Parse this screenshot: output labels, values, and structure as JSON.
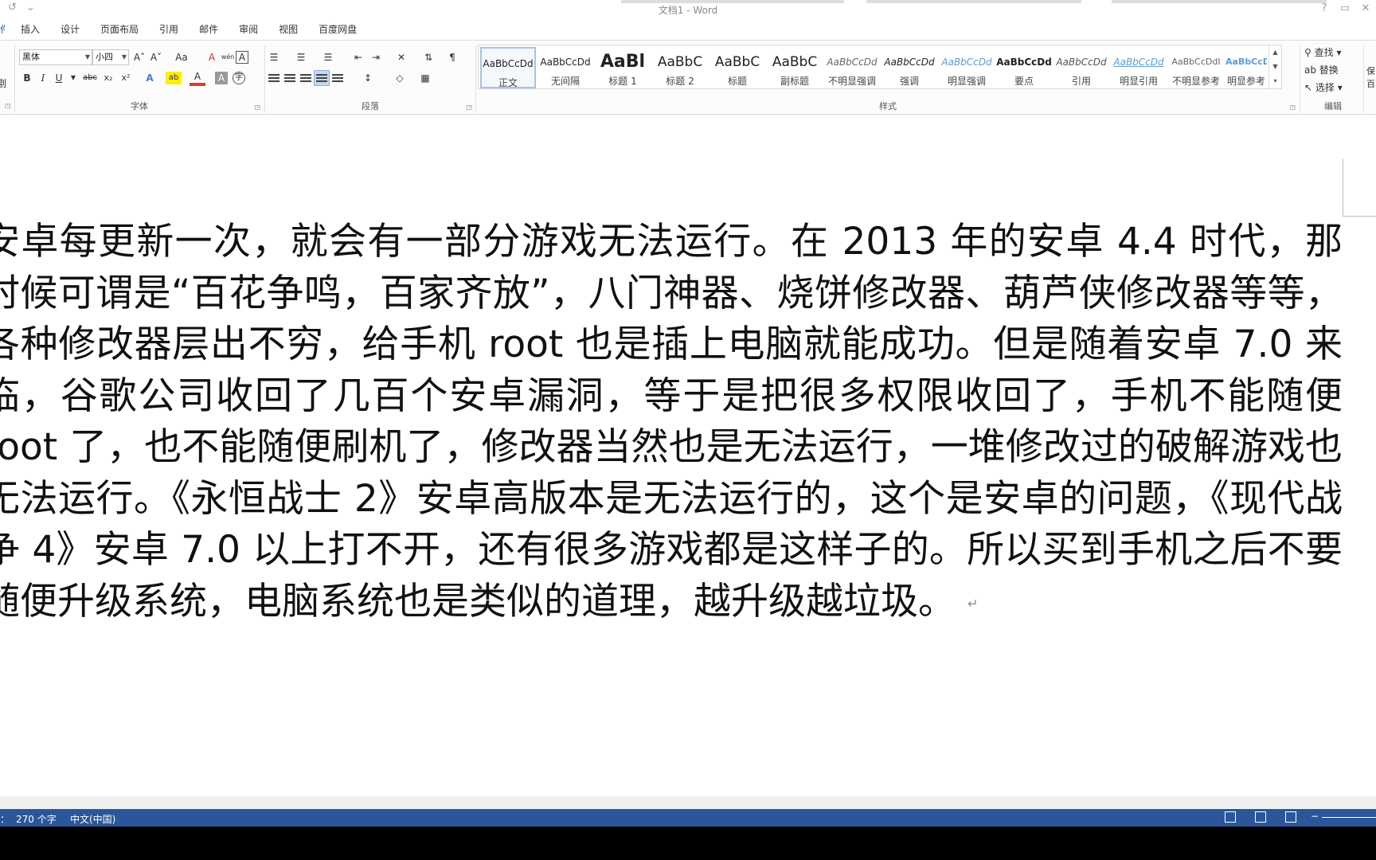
{
  "window": {
    "title": "文档1 - Word"
  },
  "qat": {
    "redo": "↺",
    "customize": "⌄"
  },
  "title_buttons": {
    "help": "?",
    "restore": "▭",
    "close": "✕"
  },
  "tabs": [
    {
      "label": "件"
    },
    {
      "label": "插入"
    },
    {
      "label": "设计"
    },
    {
      "label": "页面布局"
    },
    {
      "label": "引用"
    },
    {
      "label": "邮件"
    },
    {
      "label": "审阅"
    },
    {
      "label": "视图"
    },
    {
      "label": "百度网盘"
    }
  ],
  "clipboard_fragment": {
    "label": "剔"
  },
  "font_group": {
    "label": "字体",
    "font_name": "黑体",
    "font_size": "小四",
    "grow": "A˄",
    "shrink": "A˅",
    "change_case": "Aa",
    "clear_format": "A",
    "phonetic": "wén",
    "border_char": "A",
    "bold": "B",
    "italic": "I",
    "underline": "U",
    "strike": "abc",
    "subscript": "x₂",
    "superscript": "x²",
    "text_effect": "A",
    "highlight": "ab",
    "font_color": "A",
    "shading": "A",
    "enclose": "字"
  },
  "paragraph_group": {
    "label": "段落"
  },
  "styles_group": {
    "label": "样式",
    "items": [
      {
        "sample": "AaBbCcDd",
        "name": "正文"
      },
      {
        "sample": "AaBbCcDd",
        "name": "无间隔"
      },
      {
        "sample": "AaBl",
        "name": "标题 1"
      },
      {
        "sample": "AaBbC",
        "name": "标题 2"
      },
      {
        "sample": "AaBbC",
        "name": "标题"
      },
      {
        "sample": "AaBbC",
        "name": "副标题"
      },
      {
        "sample": "AaBbCcDd",
        "name": "不明显强调"
      },
      {
        "sample": "AaBbCcDd",
        "name": "强调"
      },
      {
        "sample": "AaBbCcDd",
        "name": "明显强调"
      },
      {
        "sample": "AaBbCcDd",
        "name": "要点"
      },
      {
        "sample": "AaBbCcDd",
        "name": "引用"
      },
      {
        "sample": "AaBbCcDd",
        "name": "明显引用"
      },
      {
        "sample": "AaBbCcDdI",
        "name": "不明显参考"
      },
      {
        "sample": "AaBbCcDo",
        "name": "明显参考"
      }
    ],
    "colors": {
      "selected_border": "#a9c1e6",
      "accent_blue": "#5b9bd5"
    }
  },
  "editing_group": {
    "label": "编辑",
    "find": "查找",
    "replace": "替换",
    "select": "选择",
    "edge_1": "保",
    "edge_2": "百"
  },
  "document": {
    "text": "安卓每更新一次，就会有一部分游戏无法运行。在 2013 年的安卓 4.4 时代，那时候可谓是“百花争鸣，百家齐放”，八门神器、烧饼修改器、葫芦侠修改器等等，各种修改器层出不穷，给手机 root 也是插上电脑就能成功。但是随着安卓 7.0 来临，谷歌公司收回了几百个安卓漏洞，等于是把很多权限收回了，手机不能随便 root 了，也不能随便刷机了，修改器当然也是无法运行，一堆修改过的破解游戏也无法运行。《永恒战士 2》安卓高版本是无法运行的，这个是安卓的问题，《现代战争 4》安卓 7.0 以上打不开，还有很多游戏都是这样子的。所以买到手机之后不要随便升级系统，电脑系统也是类似的道理，越升级越垃圾。",
    "pilcrow": "↵"
  },
  "status_bar": {
    "page_edge": "：",
    "word_count": "270 个字",
    "language": "中文(中国)",
    "color": "#2b579a"
  }
}
